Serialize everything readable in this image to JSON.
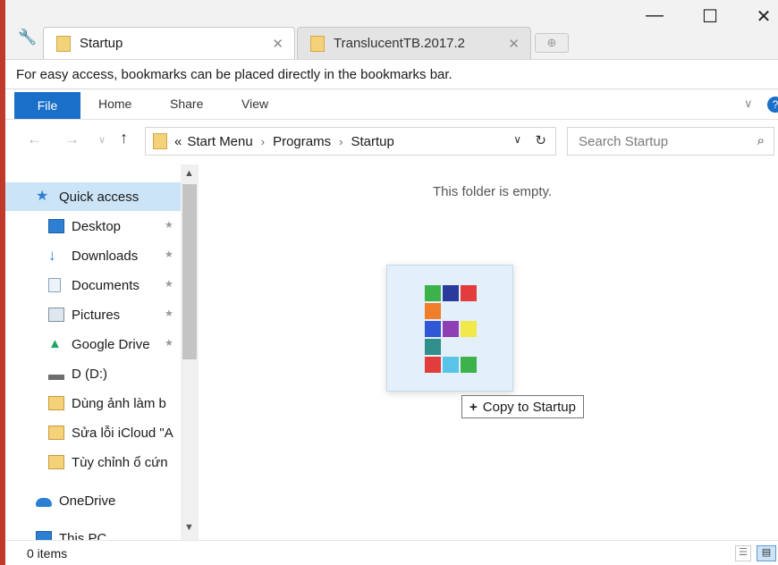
{
  "browser": {
    "tabs": [
      {
        "label": "Startup"
      },
      {
        "label": "TranslucentTB.2017.2"
      }
    ],
    "bookmark_hint": "For easy access, bookmarks can be placed directly in the bookmarks bar."
  },
  "ribbon": {
    "file": "File",
    "tabs": [
      "Home",
      "Share",
      "View"
    ]
  },
  "address": {
    "prefix": "«",
    "crumbs": [
      "Start Menu",
      "Programs",
      "Startup"
    ],
    "search_placeholder": "Search Startup"
  },
  "navpane": {
    "items": [
      {
        "label": "Quick access",
        "icon": "star-icon"
      },
      {
        "label": "Desktop",
        "icon": "desktop-icon"
      },
      {
        "label": "Downloads",
        "icon": "download-icon"
      },
      {
        "label": "Documents",
        "icon": "document-icon"
      },
      {
        "label": "Pictures",
        "icon": "pictures-icon"
      },
      {
        "label": "Google Drive",
        "icon": "google-drive-icon"
      },
      {
        "label": "D (D:)",
        "icon": "drive-icon"
      },
      {
        "label": "Dùng ảnh làm b",
        "icon": "image-folder-icon"
      },
      {
        "label": "Sửa lỗi iCloud \"A",
        "icon": "image-folder-icon"
      },
      {
        "label": "Tùy chỉnh ổ cứn",
        "icon": "image-folder-icon"
      },
      {
        "label": "OneDrive",
        "icon": "onedrive-icon"
      },
      {
        "label": "This PC",
        "icon": "pc-icon"
      }
    ]
  },
  "content": {
    "empty_message": "This folder is empty.",
    "drag_tooltip": "Copy to Startup"
  },
  "status": {
    "count": "0 items"
  },
  "colors": {
    "accent": "#1a6fc9",
    "selection": "#cce4f7",
    "folder": "#f3d27a"
  }
}
